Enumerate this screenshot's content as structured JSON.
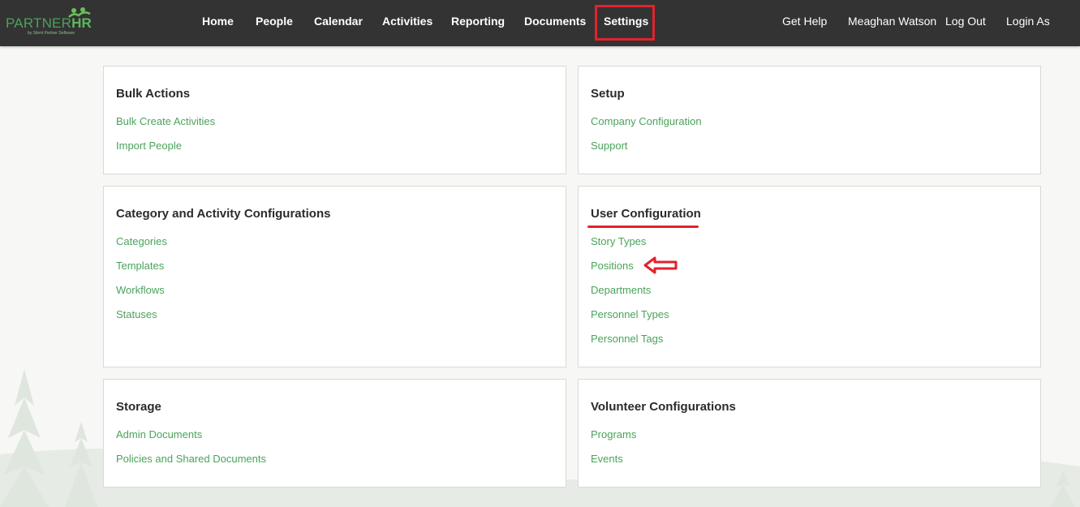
{
  "brand": {
    "name_prefix": "PARTNER",
    "name_suffix": "HR",
    "tagline": "by Silent Partner Software",
    "color": "#4aa35b"
  },
  "nav": {
    "items": [
      {
        "label": "Home"
      },
      {
        "label": "People"
      },
      {
        "label": "Calendar"
      },
      {
        "label": "Activities"
      },
      {
        "label": "Reporting"
      },
      {
        "label": "Documents"
      },
      {
        "label": "Settings",
        "highlighted": true
      }
    ],
    "right": {
      "help": "Get Help",
      "user": "Meaghan Watson",
      "logout": "Log Out",
      "login_as": "Login As"
    }
  },
  "sections": {
    "bulk_actions": {
      "title": "Bulk Actions",
      "links": [
        "Bulk Create Activities",
        "Import People"
      ]
    },
    "setup": {
      "title": "Setup",
      "links": [
        "Company Configuration",
        "Support"
      ]
    },
    "category_activity": {
      "title": "Category and Activity Configurations",
      "links": [
        "Categories",
        "Templates",
        "Workflows",
        "Statuses"
      ]
    },
    "user_configuration": {
      "title": "User Configuration",
      "links": [
        "Story Types",
        "Positions",
        "Departments",
        "Personnel Types",
        "Personnel Tags"
      ]
    },
    "storage": {
      "title": "Storage",
      "links": [
        "Admin Documents",
        "Policies and Shared Documents"
      ]
    },
    "volunteer": {
      "title": "Volunteer Configurations",
      "links": [
        "Programs",
        "Events"
      ]
    }
  },
  "colors": {
    "topbar": "#333333",
    "link": "#4aa35b",
    "annotation": "#e2222c"
  },
  "icons": {
    "logo": "partner-hr-logo",
    "annotation_arrow": "left-arrow-outline"
  }
}
